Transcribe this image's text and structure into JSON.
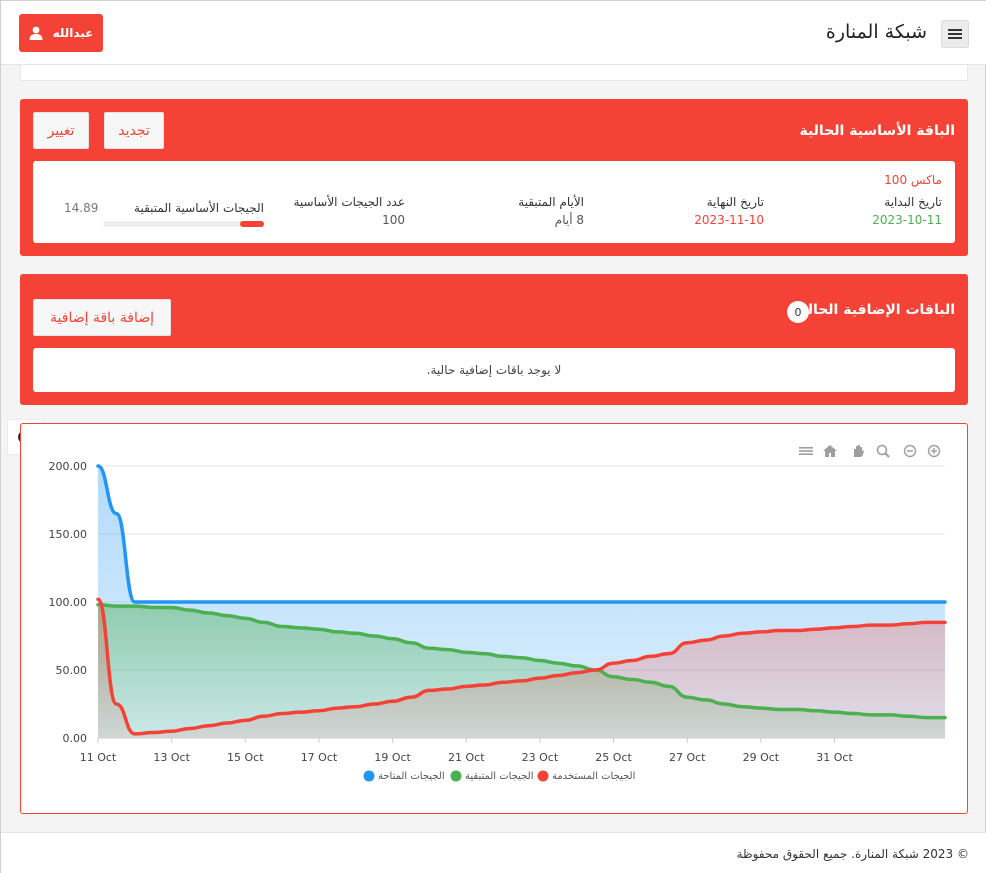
{
  "header": {
    "brand": "شبكة المنارة",
    "user_label": "عبدالله"
  },
  "base_package": {
    "title": "الباقة الأساسية الحالية",
    "renew_label": "تجديد",
    "change_label": "تغيير",
    "package_name": "ماكس 100",
    "start_date_label": "تاريخ البداية",
    "start_date": "2023-10-11",
    "end_date_label": "تاريخ النهاية",
    "end_date": "2023-11-10",
    "days_left_label": "الأيام المتبقية",
    "days_left": "8 أيام",
    "gb_count_label": "عدد الجيجات الأساسية",
    "gb_count": "100",
    "remaining_label": "الجيجات الأساسية المتبقية",
    "remaining_value": "14.89",
    "remaining_fraction": 0.1489
  },
  "addons": {
    "title": "الباقات الإضافية الحالية",
    "count": "0",
    "add_label": "إضافة باقة إضافية",
    "empty_message": "لا يوجد باقات إضافية حالية."
  },
  "colors": {
    "primary": "#f44336",
    "available": "#2196f3",
    "remaining": "#4caf50",
    "used": "#f44336"
  },
  "chart_toolbar": [
    "zoom-in-icon",
    "zoom-out-icon",
    "zoom-selection-icon",
    "pan-icon",
    "home-icon",
    "menu-icon"
  ],
  "chart_data": {
    "type": "area",
    "x_ticks": [
      "11 Oct",
      "13 Oct",
      "15 Oct",
      "17 Oct",
      "19 Oct",
      "21 Oct",
      "23 Oct",
      "25 Oct",
      "27 Oct",
      "29 Oct",
      "31 Oct"
    ],
    "y_ticks": [
      "0.00",
      "50.00",
      "100.00",
      "150.00",
      "200.00"
    ],
    "ylim": [
      0,
      200
    ],
    "x": [
      "2023-10-11T00:00",
      "2023-10-11T12:00",
      "2023-10-12T00:00",
      "2023-10-12T12:00",
      "2023-10-13T00:00",
      "2023-10-13T12:00",
      "2023-10-14T00:00",
      "2023-10-14T12:00",
      "2023-10-15T00:00",
      "2023-10-15T12:00",
      "2023-10-16T00:00",
      "2023-10-16T12:00",
      "2023-10-17T00:00",
      "2023-10-17T12:00",
      "2023-10-18T00:00",
      "2023-10-18T12:00",
      "2023-10-19T00:00",
      "2023-10-19T12:00",
      "2023-10-20T00:00",
      "2023-10-20T12:00",
      "2023-10-21T00:00",
      "2023-10-21T12:00",
      "2023-10-22T00:00",
      "2023-10-22T12:00",
      "2023-10-23T00:00",
      "2023-10-23T12:00",
      "2023-10-24T00:00",
      "2023-10-24T12:00",
      "2023-10-25T00:00",
      "2023-10-25T12:00",
      "2023-10-26T00:00",
      "2023-10-26T12:00",
      "2023-10-27T00:00",
      "2023-10-27T12:00",
      "2023-10-28T00:00",
      "2023-10-28T12:00",
      "2023-10-29T00:00",
      "2023-10-29T12:00",
      "2023-10-30T00:00",
      "2023-10-30T12:00",
      "2023-10-31T00:00",
      "2023-10-31T12:00",
      "2023-11-01T00:00",
      "2023-11-01T12:00",
      "2023-11-02T00:00",
      "2023-11-02T12:00",
      "2023-11-03T00:00"
    ],
    "series": [
      {
        "name": "الجيجات المتاحة",
        "color": "#2196f3",
        "values": [
          200,
          165,
          100,
          100,
          100,
          100,
          100,
          100,
          100,
          100,
          100,
          100,
          100,
          100,
          100,
          100,
          100,
          100,
          100,
          100,
          100,
          100,
          100,
          100,
          100,
          100,
          100,
          100,
          100,
          100,
          100,
          100,
          100,
          100,
          100,
          100,
          100,
          100,
          100,
          100,
          100,
          100,
          100,
          100,
          100,
          100,
          100
        ]
      },
      {
        "name": "الجيجات المتبقية",
        "color": "#4caf50",
        "values": [
          98,
          97,
          97,
          96,
          96,
          94,
          92,
          90,
          88,
          85,
          82,
          81,
          80,
          78,
          77,
          75,
          73,
          70,
          66,
          65,
          63,
          62,
          60,
          59,
          57,
          55,
          53,
          50,
          45,
          43,
          41,
          38,
          30,
          28,
          25,
          23,
          22,
          21,
          21,
          20,
          19,
          18,
          17,
          17,
          16,
          15,
          15
        ]
      },
      {
        "name": "الجيجات المستخدمة",
        "color": "#f44336",
        "values": [
          102,
          25,
          3,
          4,
          5,
          7,
          9,
          11,
          13,
          16,
          18,
          19,
          20,
          22,
          23,
          25,
          27,
          30,
          35,
          36,
          38,
          39,
          41,
          42,
          44,
          46,
          48,
          50,
          55,
          57,
          60,
          62,
          70,
          72,
          75,
          77,
          78,
          79,
          79,
          80,
          81,
          82,
          83,
          83,
          84,
          85,
          85
        ]
      }
    ]
  },
  "footer": {
    "copyright": "© 2023 شبكة المنارة. جميع الحقوق محفوظة"
  }
}
